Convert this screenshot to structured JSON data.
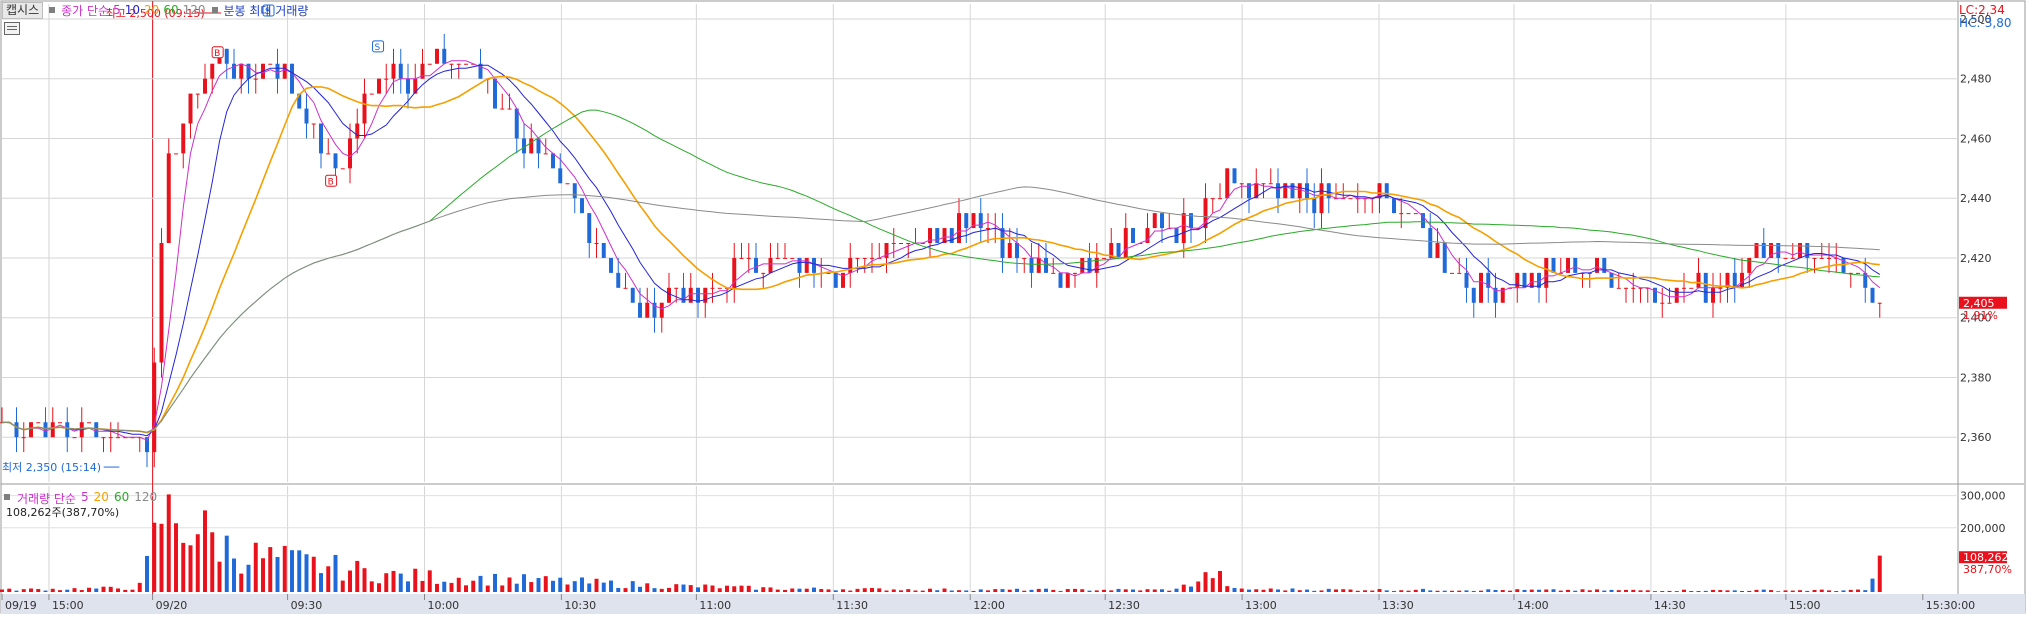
{
  "header": {
    "name_tag": "캡시스",
    "close_ma_label": "종가 단순",
    "ma_periods": [
      "5",
      "10",
      "20",
      "60",
      "120"
    ],
    "chart_mode_label": "분봉 최대 거래량"
  },
  "volume_header": {
    "label": "거래량 단순",
    "ma_periods": [
      "5",
      "20",
      "60",
      "120"
    ],
    "current_value": "108,262주(387,70%)"
  },
  "right_info": {
    "lc": "LC:2,34",
    "hc": "HC:-3,80"
  },
  "annotations": {
    "high": "최고 2,500 (09:15)",
    "low": "최저 2,350 (15:14)"
  },
  "current": {
    "price": "2,405",
    "change": "1.91%",
    "volume": "108,262",
    "volume_ratio": "387,70%"
  },
  "colors": {
    "up": "#e8111c",
    "down": "#1f6ad8",
    "ma5": "#cc31cc",
    "ma10": "#2424d6",
    "ma20": "#f5a000",
    "ma60": "#2aa92a",
    "ma120": "#8a8a8a"
  },
  "signals": [
    "B",
    "S"
  ],
  "chart_data": {
    "type": "candlestick",
    "price_axis": {
      "ticks": [
        2360,
        2380,
        2400,
        2420,
        2440,
        2460,
        2480,
        2500
      ],
      "tick_labels": [
        "2,360",
        "2,380",
        "2,400",
        "2,420",
        "2,440",
        "2,460",
        "2,480",
        "2,500"
      ]
    },
    "volume_axis": {
      "ticks": [
        200000,
        300000
      ],
      "tick_labels": [
        "200,000",
        "300,000"
      ]
    },
    "time_labels": [
      "09/19",
      "15:00",
      "09/20",
      "09:30",
      "10:00",
      "10:30",
      "11:00",
      "11:30",
      "12:00",
      "12:30",
      "13:00",
      "13:30",
      "14:00",
      "14:30",
      "15:00",
      "15:30:00"
    ],
    "high": 2500,
    "low": 2350,
    "last_close": 2405,
    "price_path": [
      [
        0,
        2365
      ],
      [
        0.075,
        2360
      ],
      [
        0.078,
        2390
      ],
      [
        0.085,
        2450
      ],
      [
        0.095,
        2470
      ],
      [
        0.11,
        2490
      ],
      [
        0.125,
        2480
      ],
      [
        0.14,
        2485
      ],
      [
        0.155,
        2470
      ],
      [
        0.17,
        2448
      ],
      [
        0.185,
        2470
      ],
      [
        0.195,
        2485
      ],
      [
        0.21,
        2480
      ],
      [
        0.23,
        2488
      ],
      [
        0.245,
        2482
      ],
      [
        0.26,
        2465
      ],
      [
        0.29,
        2440
      ],
      [
        0.31,
        2420
      ],
      [
        0.325,
        2400
      ],
      [
        0.34,
        2410
      ],
      [
        0.36,
        2405
      ],
      [
        0.38,
        2420
      ],
      [
        0.41,
        2418
      ],
      [
        0.43,
        2415
      ],
      [
        0.45,
        2425
      ],
      [
        0.48,
        2430
      ],
      [
        0.5,
        2435
      ],
      [
        0.52,
        2420
      ],
      [
        0.54,
        2412
      ],
      [
        0.565,
        2425
      ],
      [
        0.59,
        2430
      ],
      [
        0.61,
        2430
      ],
      [
        0.625,
        2445
      ],
      [
        0.65,
        2440
      ],
      [
        0.68,
        2440
      ],
      [
        0.71,
        2440
      ],
      [
        0.73,
        2425
      ],
      [
        0.75,
        2410
      ],
      [
        0.78,
        2412
      ],
      [
        0.8,
        2418
      ],
      [
        0.82,
        2415
      ],
      [
        0.84,
        2408
      ],
      [
        0.86,
        2408
      ],
      [
        0.88,
        2412
      ],
      [
        0.9,
        2425
      ],
      [
        0.93,
        2420
      ],
      [
        0.95,
        2410
      ],
      [
        0.96,
        2405
      ]
    ],
    "volume_profile": [
      [
        0,
        8000
      ],
      [
        0.07,
        15000
      ],
      [
        0.077,
        150000
      ],
      [
        0.08,
        290000
      ],
      [
        0.1,
        230000
      ],
      [
        0.12,
        140000
      ],
      [
        0.17,
        90000
      ],
      [
        0.2,
        60000
      ],
      [
        0.28,
        40000
      ],
      [
        0.33,
        25000
      ],
      [
        0.4,
        12000
      ],
      [
        0.5,
        8000
      ],
      [
        0.6,
        8000
      ],
      [
        0.62,
        70000
      ],
      [
        0.63,
        10000
      ],
      [
        0.7,
        8000
      ],
      [
        0.85,
        6000
      ],
      [
        0.955,
        6000
      ],
      [
        0.958,
        108262
      ]
    ]
  }
}
